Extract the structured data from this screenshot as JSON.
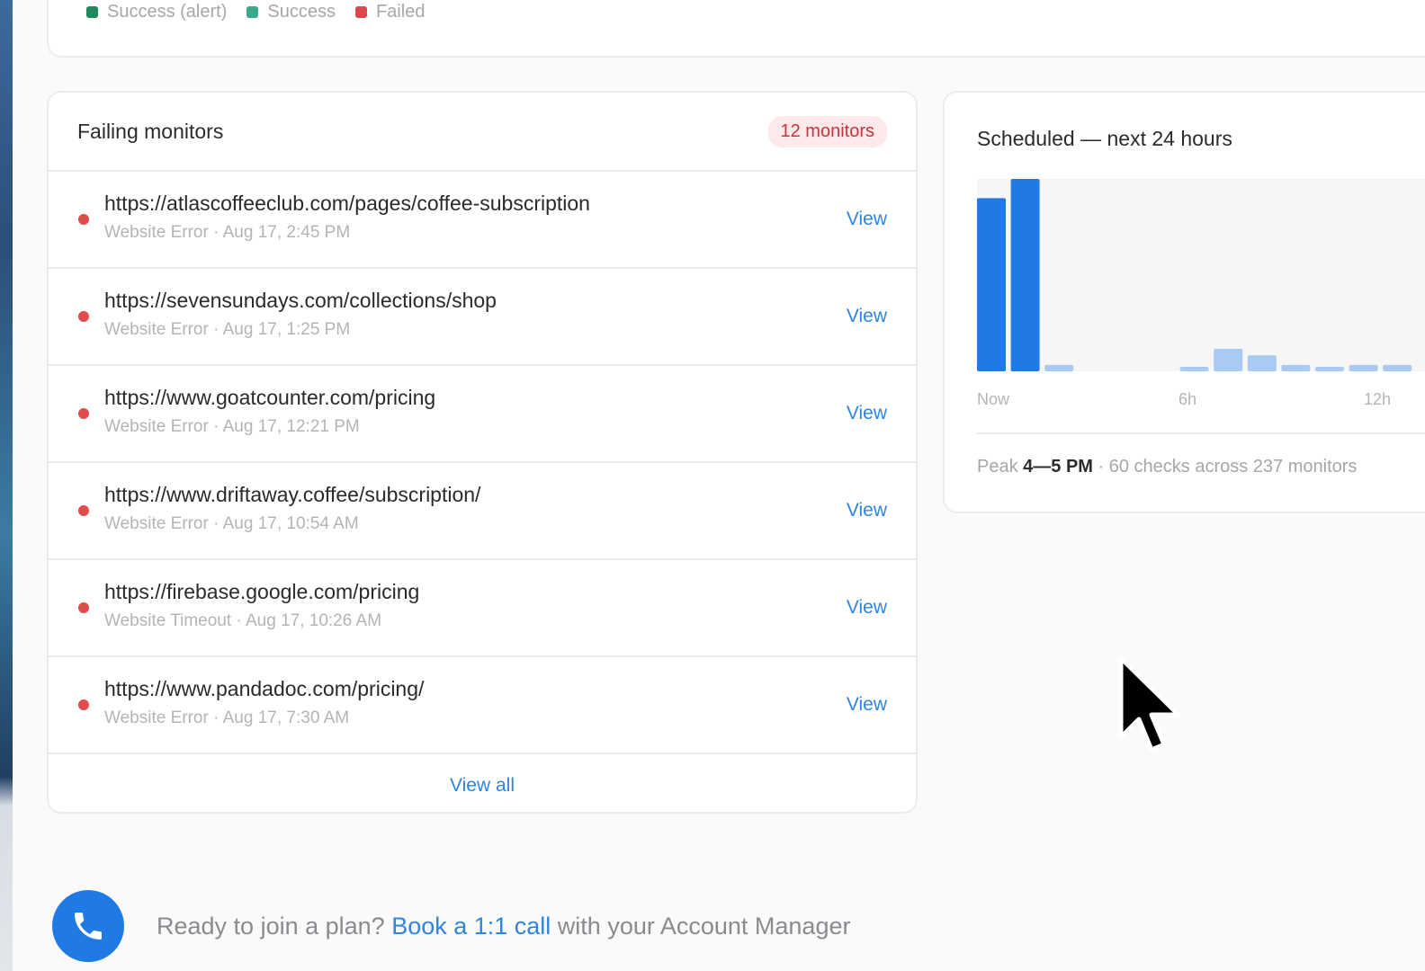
{
  "legend": [
    {
      "label": "Success (alert)",
      "color": "#1f8a5e"
    },
    {
      "label": "Success",
      "color": "#3aa88a"
    },
    {
      "label": "Failed",
      "color": "#e0454a"
    }
  ],
  "failing": {
    "title": "Failing monitors",
    "badge": "12 monitors",
    "rows": [
      {
        "url": "https://atlascoffeeclub.com/pages/coffee-subscription",
        "meta": "Website Error · Aug 17, 2:45 PM",
        "action": "View"
      },
      {
        "url": "https://sevensundays.com/collections/shop",
        "meta": "Website Error · Aug 17, 1:25 PM",
        "action": "View"
      },
      {
        "url": "https://www.goatcounter.com/pricing",
        "meta": "Website Error · Aug 17, 12:21 PM",
        "action": "View"
      },
      {
        "url": "https://www.driftaway.coffee/subscription/",
        "meta": "Website Error · Aug 17, 10:54 AM",
        "action": "View"
      },
      {
        "url": "https://firebase.google.com/pricing",
        "meta": "Website Timeout · Aug 17, 10:26 AM",
        "action": "View"
      },
      {
        "url": "https://www.pandadoc.com/pricing/",
        "meta": "Website Error · Aug 17, 7:30 AM",
        "action": "View"
      }
    ],
    "view_all": "View all"
  },
  "scheduled": {
    "title": "Scheduled — next 24 hours",
    "footer_prefix": "Peak ",
    "footer_peak": "4—5 PM",
    "footer_suffix": " · 60 checks across 237 monitors"
  },
  "chart_data": {
    "type": "bar",
    "x_tick_labels": [
      "Now",
      "6h",
      "12h"
    ],
    "bars": [
      {
        "hour": 0,
        "value": 54,
        "highlight": true
      },
      {
        "hour": 1,
        "value": 60,
        "highlight": true
      },
      {
        "hour": 2,
        "value": 2,
        "highlight": false
      },
      {
        "hour": 3,
        "value": 0,
        "highlight": false
      },
      {
        "hour": 4,
        "value": 0,
        "highlight": false
      },
      {
        "hour": 5,
        "value": 0,
        "highlight": false
      },
      {
        "hour": 6,
        "value": 1,
        "highlight": false
      },
      {
        "hour": 7,
        "value": 7,
        "highlight": false
      },
      {
        "hour": 8,
        "value": 5,
        "highlight": false
      },
      {
        "hour": 9,
        "value": 2,
        "highlight": false
      },
      {
        "hour": 10,
        "value": 1,
        "highlight": false
      },
      {
        "hour": 11,
        "value": 2,
        "highlight": false
      },
      {
        "hour": 12,
        "value": 2,
        "highlight": false
      }
    ],
    "ylim": [
      0,
      60
    ],
    "colors": {
      "highlight": "#1f7ae6",
      "normal": "#a9cbf3"
    }
  },
  "cta": {
    "prefix": "Ready to join a plan? ",
    "link": "Book a 1:1 call",
    "suffix": " with your Account Manager"
  }
}
